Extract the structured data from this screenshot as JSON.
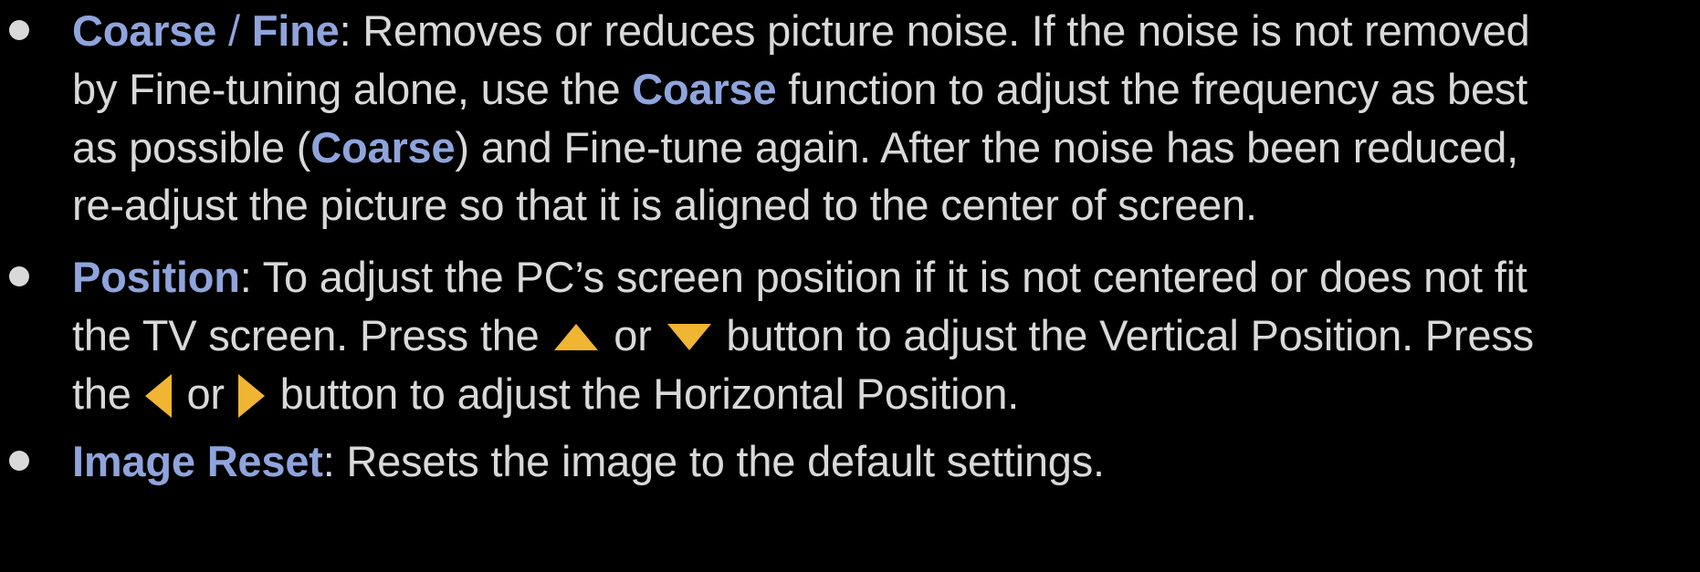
{
  "colors": {
    "background": "#000000",
    "text": "#d9d9d9",
    "keyword": "#8fa4dc",
    "arrow": "#f0b533"
  },
  "items": [
    {
      "term1": "Coarse",
      "separator": " / ",
      "term2": "Fine",
      "line1_rest": ": Removes or reduces picture noise. If the noise is not removed",
      "line2_pre": "by Fine-tuning alone, use the ",
      "line2_kw": "Coarse",
      "line2_post": " function to adjust the frequency as best",
      "line3_pre": "as possible (",
      "line3_kw": "Coarse",
      "line3_post": ") and Fine-tune again. After the noise has been reduced,",
      "line4": "re-adjust the picture so that it is aligned to the center of screen."
    },
    {
      "term": "Position",
      "line1_rest": ": To adjust the PC’s screen position if it is not centered or does not fit",
      "line2_pre": "the TV screen. Press the ",
      "line2_or": " or ",
      "line2_post": " button to adjust the Vertical Position. Press",
      "line3_pre": "the ",
      "line3_or": " or ",
      "line3_post": " button to adjust the Horizontal Position.",
      "icons": [
        "up-arrow-icon",
        "down-arrow-icon",
        "left-arrow-icon",
        "right-arrow-icon"
      ]
    },
    {
      "term": "Image Reset",
      "line1_rest": ": Resets the image to the default settings."
    }
  ]
}
